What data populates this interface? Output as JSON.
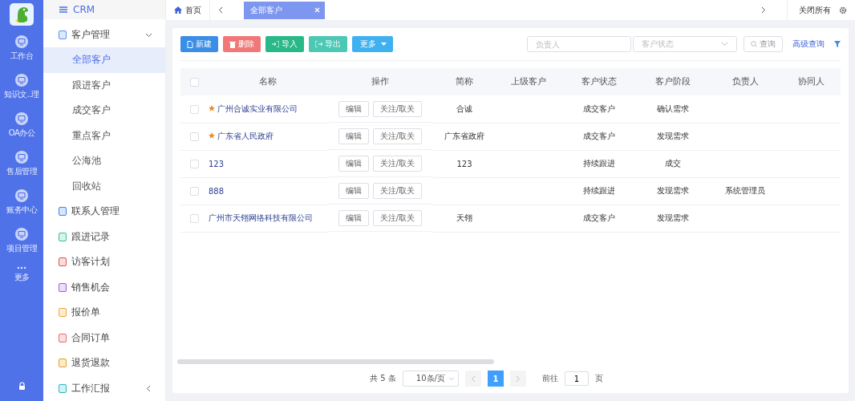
{
  "rail": {
    "items": [
      {
        "label": "工作台",
        "kind": "monitor"
      },
      {
        "label": "知识文..理",
        "kind": "monitor"
      },
      {
        "label": "OA办公",
        "kind": "monitor"
      },
      {
        "label": "售后管理",
        "kind": "monitor"
      },
      {
        "label": "账务中心",
        "kind": "monitor"
      },
      {
        "label": "项目管理",
        "kind": "monitor"
      },
      {
        "label": "更多",
        "kind": "dots"
      }
    ]
  },
  "sidebar": {
    "title": "CRM",
    "items": [
      {
        "label": "客户管理",
        "color": "#5b8ff9",
        "expanded": true,
        "children": [
          {
            "label": "全部客户",
            "selected": true
          },
          {
            "label": "跟进客户",
            "selected": false
          },
          {
            "label": "成交客户",
            "selected": false
          },
          {
            "label": "重点客户",
            "selected": false
          },
          {
            "label": "公海池",
            "selected": false
          },
          {
            "label": "回收站",
            "selected": false
          }
        ]
      },
      {
        "label": "联系人管理",
        "color": "#3b82f6"
      },
      {
        "label": "跟进记录",
        "color": "#34c3a0"
      },
      {
        "label": "访客计划",
        "color": "#e05252"
      },
      {
        "label": "销售机会",
        "color": "#a25bd6"
      },
      {
        "label": "报价单",
        "color": "#f0a830"
      },
      {
        "label": "合同订单",
        "color": "#e86a6a"
      },
      {
        "label": "退货退款",
        "color": "#e8a020"
      },
      {
        "label": "工作汇报",
        "color": "#2bb5c4",
        "expanded": false
      }
    ]
  },
  "tabs": {
    "home": "首页",
    "items": [
      {
        "label": "全部客户",
        "selected": true
      }
    ],
    "close_all": "关闭所有"
  },
  "toolbar": {
    "buttons": [
      {
        "label": "新建",
        "color": "#3a8ee6",
        "kind": "file"
      },
      {
        "label": "删除",
        "color": "#f07878",
        "kind": "trash"
      },
      {
        "label": "导入",
        "color": "#29b888",
        "kind": "in"
      },
      {
        "label": "导出",
        "color": "#4cc8b4",
        "kind": "out"
      },
      {
        "label": "更多",
        "color": "#3fb1f0",
        "kind": "menu"
      }
    ],
    "owner_placeholder": "负责人",
    "status_placeholder": "客户状态",
    "search": "查询",
    "advanced": "高级查询"
  },
  "table": {
    "select_all_checked": false,
    "columns": [
      "名称",
      "操作",
      "简称",
      "上级客户",
      "客户状态",
      "客户阶段",
      "负责人",
      "协同人"
    ],
    "rows": [
      {
        "checked": false,
        "starred": true,
        "name": "广州合诚实业有限公司",
        "edit": "编辑",
        "follow": "关注/取关",
        "short": "合诚",
        "status": "成交客户",
        "stage": "确认需求"
      },
      {
        "checked": false,
        "starred": true,
        "name": "广东省人民政府",
        "edit": "编辑",
        "follow": "关注/取关",
        "short": "广东省政府",
        "status": "成交客户",
        "stage": "发现需求"
      },
      {
        "checked": false,
        "starred": false,
        "name": "123",
        "edit": "编辑",
        "follow": "关注/取关",
        "short": "123",
        "status": "持续跟进",
        "stage": "成交"
      },
      {
        "checked": false,
        "starred": false,
        "name": "888",
        "edit": "编辑",
        "follow": "关注/取关",
        "status": "持续跟进",
        "stage": "发现需求",
        "owner": "系统管理员"
      },
      {
        "checked": false,
        "starred": false,
        "name": "广州市天翎网络科技有限公司",
        "edit": "编辑",
        "follow": "关注/取关",
        "short": "天翎",
        "status": "成交客户",
        "stage": "发现需求"
      }
    ]
  },
  "pagination": {
    "total": "共 5 条",
    "size": "10条/页",
    "pages": [
      {
        "label": "1",
        "selected": true
      }
    ],
    "goto": "前往",
    "page_value": "1",
    "page_unit": "页"
  }
}
